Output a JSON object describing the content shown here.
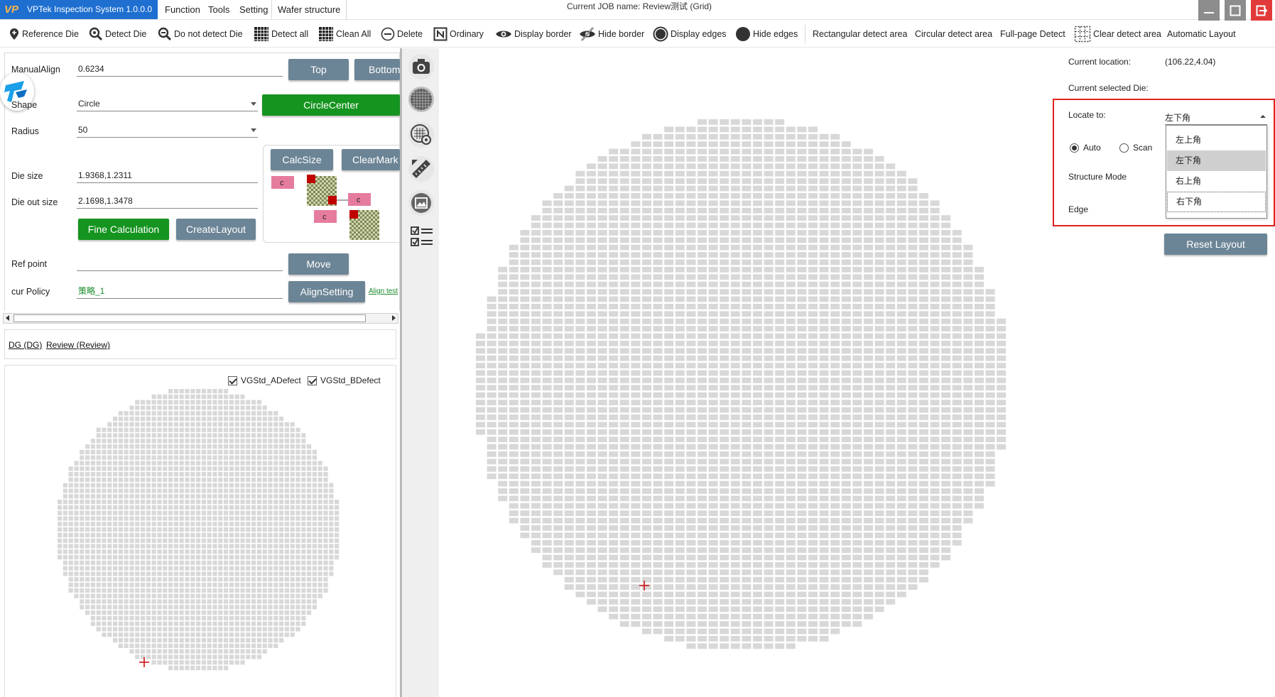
{
  "app": {
    "title": "VPTek Inspection System 1.0.0.0",
    "logo_text": "VP",
    "job_name": "Current JOB name:  Review测试 (Grid)"
  },
  "menu": [
    "Function",
    "Tools",
    "Setting",
    "Wafer structure"
  ],
  "toolbar": [
    {
      "label": "Reference Die",
      "icon": "pin-icon"
    },
    {
      "label": "Detect Die",
      "icon": "magnifier-icon"
    },
    {
      "label": "Do not detect Die",
      "icon": "magnifier-minus-icon"
    },
    {
      "label": "Detect all",
      "icon": "grid-icon"
    },
    {
      "label": "Clean All",
      "icon": "grid-icon"
    },
    {
      "label": "Delete",
      "icon": "minus-circle-icon"
    },
    {
      "label": "Ordinary",
      "icon": "n-box-icon"
    },
    {
      "label": "Display border",
      "icon": "eye-icon"
    },
    {
      "label": "Hide border",
      "icon": "eye-off-icon"
    },
    {
      "label": "Display edges",
      "icon": "ring-icon"
    },
    {
      "label": "Hide edges",
      "icon": "filled-circle-icon"
    },
    {
      "label": "Rectangular detect area",
      "icon": ""
    },
    {
      "label": "Circular detect area",
      "icon": ""
    },
    {
      "label": "Full-page Detect",
      "icon": ""
    },
    {
      "label": "Clear detect area",
      "icon": "dotted-grid-icon"
    },
    {
      "label": "Automatic Layout",
      "icon": ""
    }
  ],
  "form": {
    "manual_align_label": "ManualAlign",
    "manual_align_value": "0.6234",
    "shape_label": "Shape",
    "shape_value": "Circle",
    "radius_label": "Radius",
    "radius_value": "50",
    "die_size_label": "Die size",
    "die_size_value": "1.9368,1.2311",
    "die_out_size_label": "Die out size",
    "die_out_size_value": "2.1698,1.3478",
    "ref_point_label": "Ref point",
    "ref_point_value": "",
    "cur_policy_label": "cur Policy",
    "cur_policy_value": "策略_1",
    "buttons": {
      "top": "Top",
      "bottom": "Bottom",
      "circle_center": "CircleCenter",
      "calc_size": "CalcSize",
      "clear_mark": "ClearMark",
      "fine_calc": "Fine Calculation",
      "create_layout": "CreateLayout",
      "move": "Move",
      "align_setting": "AlignSetting",
      "align_test": "Align test"
    },
    "diagram_marker": "c"
  },
  "tabs": [
    "DG (DG)",
    "Review (Review)"
  ],
  "defect_filters": [
    {
      "label": "VGStd_ADefect",
      "checked": true
    },
    {
      "label": "VGStd_BDefect",
      "checked": true
    }
  ],
  "side_icons": [
    "camera-icon",
    "wafer-grid-icon",
    "wafer-target-icon",
    "ruler-icon",
    "image-frame-icon",
    "checklist-icon"
  ],
  "info": {
    "current_location_label": "Current location:",
    "current_location_value": "(106.22,4.04)",
    "current_die_label": "Current selected Die:",
    "current_die_value": "",
    "locate_to_label": "Locate to:",
    "locate_to_value": "左下角",
    "radio_auto": "Auto",
    "radio_scan": "Scan",
    "radio_selected": "Auto",
    "structure_mode_label": "Structure Mode",
    "edge_label": "Edge",
    "dropdown_options": [
      "左上角",
      "左下角",
      "右上角",
      "右下角"
    ],
    "dropdown_selected_index": 1,
    "dropdown_focus_index": 3,
    "reset_layout": "Reset Layout"
  },
  "colors": {
    "brand_blue": "#1e6fd0",
    "button_slate": "#6c8596",
    "button_green": "#15941f",
    "die_gray": "#d8d8d8",
    "marker_red": "#cc1111",
    "highlight_red": "#e0231f"
  }
}
